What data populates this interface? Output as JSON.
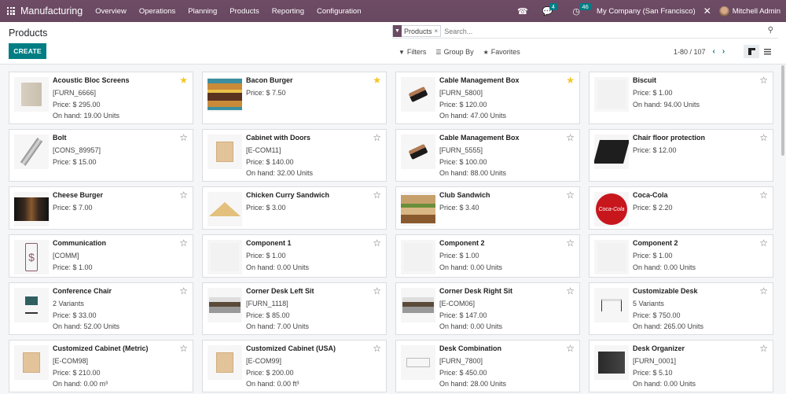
{
  "navbar": {
    "app_name": "Manufacturing",
    "menu": [
      "Overview",
      "Operations",
      "Planning",
      "Products",
      "Reporting",
      "Configuration"
    ],
    "messages_count": "4",
    "activities_count": "46",
    "company": "My Company (San Francisco)",
    "user": "Mitchell Admin"
  },
  "control": {
    "title": "Products",
    "create_label": "CREATE",
    "facet_label": "Products",
    "facet_remove": "×",
    "search_placeholder": "Search...",
    "filters_label": "Filters",
    "group_by_label": "Group By",
    "favorites_label": "Favorites",
    "pager": "1-80 / 107"
  },
  "products": [
    {
      "name": "Acoustic Bloc Screens",
      "ref": "[FURN_6666]",
      "price": "Price: $ 295.00",
      "on_hand": "On hand: 19.00 Units",
      "favorite": true,
      "thumb": "screen"
    },
    {
      "name": "Bacon Burger",
      "ref": "",
      "price": "Price: $ 7.50",
      "on_hand": "",
      "favorite": true,
      "thumb": "burger"
    },
    {
      "name": "Cable Management Box",
      "ref": "[FURN_5800]",
      "price": "Price: $ 120.00",
      "on_hand": "On hand: 47.00 Units",
      "favorite": true,
      "thumb": "box"
    },
    {
      "name": "Biscuit",
      "ref": "",
      "price": "Price: $ 1.00",
      "on_hand": "On hand: 94.00 Units",
      "favorite": false,
      "thumb": "placeholder"
    },
    {
      "name": "Bolt",
      "ref": "[CONS_89957]",
      "price": "Price: $ 15.00",
      "on_hand": "",
      "favorite": false,
      "thumb": "bolt"
    },
    {
      "name": "Cabinet with Doors",
      "ref": "[E-COM11]",
      "price": "Price: $ 140.00",
      "on_hand": "On hand: 32.00 Units",
      "favorite": false,
      "thumb": "cabinet"
    },
    {
      "name": "Cable Management Box",
      "ref": "[FURN_5555]",
      "price": "Price: $ 100.00",
      "on_hand": "On hand: 88.00 Units",
      "favorite": false,
      "thumb": "box"
    },
    {
      "name": "Chair floor protection",
      "ref": "",
      "price": "Price: $ 12.00",
      "on_hand": "",
      "favorite": false,
      "thumb": "mat"
    },
    {
      "name": "Cheese Burger",
      "ref": "",
      "price": "Price: $ 7.00",
      "on_hand": "",
      "favorite": false,
      "thumb": "burger-dark"
    },
    {
      "name": "Chicken Curry Sandwich",
      "ref": "",
      "price": "Price: $ 3.00",
      "on_hand": "",
      "favorite": false,
      "thumb": "sandwich"
    },
    {
      "name": "Club Sandwich",
      "ref": "",
      "price": "Price: $ 3.40",
      "on_hand": "",
      "favorite": false,
      "thumb": "club"
    },
    {
      "name": "Coca-Cola",
      "ref": "",
      "price": "Price: $ 2.20",
      "on_hand": "",
      "favorite": false,
      "thumb": "cola"
    },
    {
      "name": "Communication",
      "ref": "[COMM]",
      "price": "Price: $ 1.00",
      "on_hand": "",
      "favorite": false,
      "thumb": "phone"
    },
    {
      "name": "Component 1",
      "ref": "",
      "price": "Price: $ 1.00",
      "on_hand": "On hand: 0.00 Units",
      "favorite": false,
      "thumb": "placeholder"
    },
    {
      "name": "Component 2",
      "ref": "",
      "price": "Price: $ 1.00",
      "on_hand": "On hand: 0.00 Units",
      "favorite": false,
      "thumb": "placeholder"
    },
    {
      "name": "Component 2",
      "ref": "",
      "price": "Price: $ 1.00",
      "on_hand": "On hand: 0.00 Units",
      "favorite": false,
      "thumb": "placeholder"
    },
    {
      "name": "Conference Chair",
      "ref": "2 Variants",
      "price": "Price: $ 33.00",
      "on_hand": "On hand: 52.00 Units",
      "favorite": false,
      "thumb": "chair"
    },
    {
      "name": "Corner Desk Left Sit",
      "ref": "[FURN_1118]",
      "price": "Price: $ 85.00",
      "on_hand": "On hand: 7.00 Units",
      "favorite": false,
      "thumb": "desk"
    },
    {
      "name": "Corner Desk Right Sit",
      "ref": "[E-COM06]",
      "price": "Price: $ 147.00",
      "on_hand": "On hand: 0.00 Units",
      "favorite": false,
      "thumb": "desk"
    },
    {
      "name": "Customizable Desk",
      "ref": "5 Variants",
      "price": "Price: $ 750.00",
      "on_hand": "On hand: 265.00 Units",
      "favorite": false,
      "thumb": "table"
    },
    {
      "name": "Customized Cabinet (Metric)",
      "ref": "[E-COM98]",
      "price": "Price: $ 210.00",
      "on_hand": "On hand: 0.00 m³",
      "favorite": false,
      "thumb": "cabinet"
    },
    {
      "name": "Customized Cabinet (USA)",
      "ref": "[E-COM99]",
      "price": "Price: $ 200.00",
      "on_hand": "On hand: 0.00 ft³",
      "favorite": false,
      "thumb": "cabinet"
    },
    {
      "name": "Desk Combination",
      "ref": "[FURN_7800]",
      "price": "Price: $ 450.00",
      "on_hand": "On hand: 28.00 Units",
      "favorite": false,
      "thumb": "combo"
    },
    {
      "name": "Desk Organizer",
      "ref": "[FURN_0001]",
      "price": "Price: $ 5.10",
      "on_hand": "On hand: 0.00 Units",
      "favorite": false,
      "thumb": "organizer"
    }
  ]
}
